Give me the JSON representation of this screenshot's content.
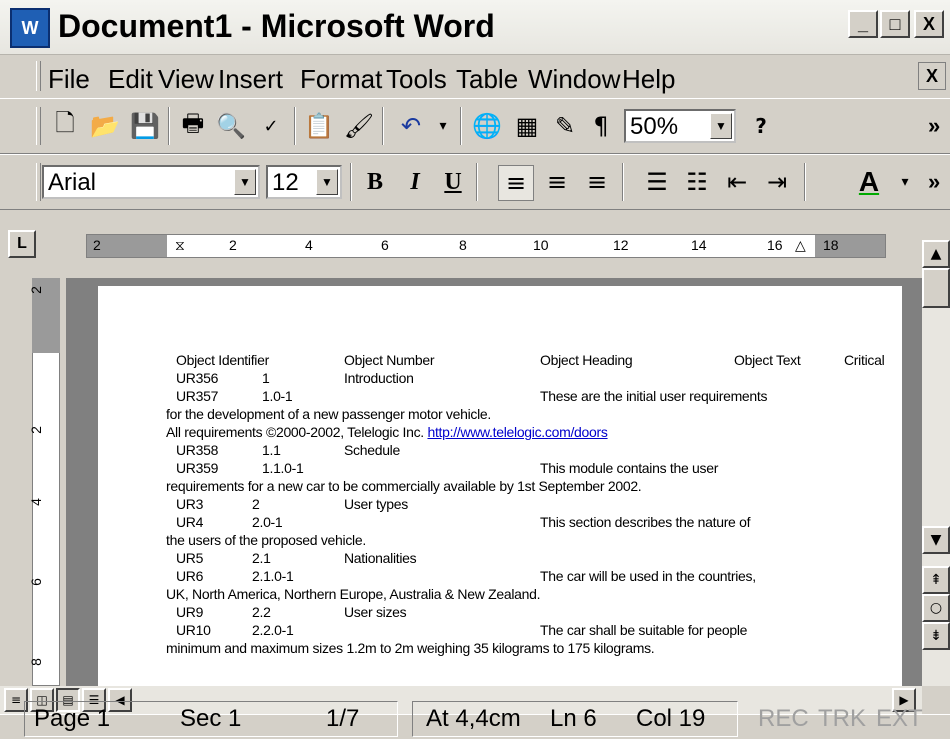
{
  "window": {
    "title": "Document1 - Microsoft Word",
    "app_icon": "W",
    "controls": [
      "_",
      "□",
      "X"
    ]
  },
  "menu": {
    "items": [
      "File",
      "Edit",
      "View",
      "Insert",
      "Format",
      "Tools",
      "Table",
      "Window",
      "Help"
    ],
    "close_label": "X"
  },
  "standard_toolbar": {
    "zoom": "50%",
    "icons": [
      "new-icon",
      "open-icon",
      "save-icon",
      "print-icon",
      "print-preview-icon",
      "spelling-icon",
      "paste-icon",
      "format-painter-icon",
      "undo-icon",
      "hyperlink-icon",
      "tables-borders-icon",
      "drawing-icon",
      "show-formatting-icon",
      "help-icon"
    ],
    "pilcrow": "¶",
    "help": "?"
  },
  "formatting_toolbar": {
    "font": "Arial",
    "size": "12",
    "bold": "B",
    "italic": "I",
    "underline": "U",
    "font_color": "A",
    "font_color_hex": "#00aa00"
  },
  "ruler": {
    "marks": [
      "2",
      "2",
      "4",
      "6",
      "8",
      "10",
      "12",
      "14",
      "16",
      "18"
    ],
    "tab_selector": "L"
  },
  "vertical_ruler": {
    "marks": [
      "2",
      "2",
      "4",
      "6",
      "8"
    ]
  },
  "document": {
    "header": [
      "Object Identifier",
      "Object Number",
      "Object Heading",
      "Object Text",
      "Critical"
    ],
    "lines": [
      {
        "id": "UR356",
        "num": "1",
        "heading": "Introduction",
        "text": ""
      },
      {
        "id": "UR357",
        "num": "1.0-1",
        "heading": "",
        "text": "These are the initial user requirements"
      },
      {
        "wrap": "for the development of a new passenger motor vehicle."
      },
      {
        "wrap_pre": "All requirements ©2000-2002, Telelogic Inc. ",
        "link": "http://www.telelogic.com/doors"
      },
      {
        "id": "UR358",
        "num": "1.1",
        "heading": "Schedule",
        "text": ""
      },
      {
        "id": "UR359",
        "num": "1.1.0-1",
        "heading": "",
        "text": "This module contains the user"
      },
      {
        "wrap": "requirements for a new car to be commercially available by 1st September 2002."
      },
      {
        "id": "UR3",
        "num": "2",
        "heading": "User types",
        "text": ""
      },
      {
        "id": "UR4",
        "num": "2.0-1",
        "heading": "",
        "text": "This section describes the nature of"
      },
      {
        "wrap": "the users of the proposed vehicle."
      },
      {
        "id": "UR5",
        "num": "2.1",
        "heading": "Nationalities",
        "text": ""
      },
      {
        "id": "UR6",
        "num": "2.1.0-1",
        "heading": "",
        "text": "The car will be used in the countries,"
      },
      {
        "wrap": "UK, North America, Northern Europe, Australia & New Zealand."
      },
      {
        "id": "UR9",
        "num": "2.2",
        "heading": "User sizes",
        "text": ""
      },
      {
        "id": "UR10",
        "num": "2.2.0-1",
        "heading": "",
        "text": "The car shall be suitable for people"
      },
      {
        "wrap": "minimum and maximum sizes 1.2m to 2m weighing 35 kilograms to 175 kilograms."
      }
    ]
  },
  "statusbar": {
    "page": "Page 1",
    "sec": "Sec 1",
    "pages": "1/7",
    "at": "At 4,4cm",
    "ln": "Ln 6",
    "col": "Col 19",
    "rec": "REC",
    "trk": "TRK",
    "ext": "EXT"
  }
}
